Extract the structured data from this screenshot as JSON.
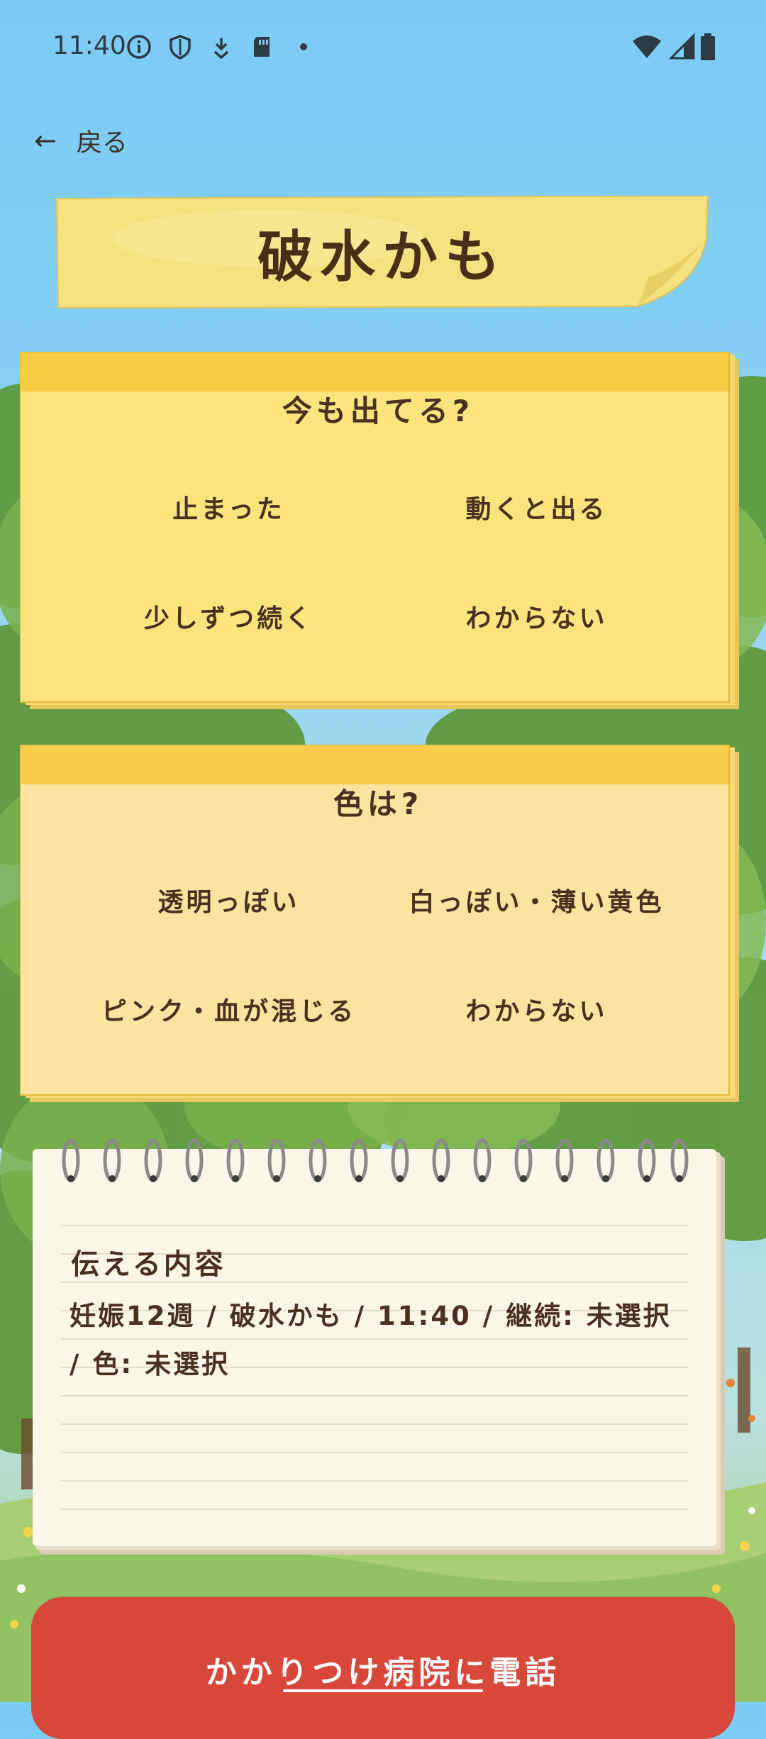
{
  "status_bar": {
    "time": "11:40",
    "left_icons": [
      "info-icon",
      "shield-icon",
      "download-icon",
      "sd-card-icon",
      "dot-icon"
    ],
    "right_icons": [
      "wifi-icon",
      "cell-signal-icon",
      "battery-icon"
    ]
  },
  "nav": {
    "back_label": "戻る",
    "back_icon": "arrow-left-icon"
  },
  "page": {
    "title": "破水かも"
  },
  "questions": [
    {
      "title": "今も出てる?",
      "options": [
        "止まった",
        "動くと出る",
        "少しずつ続く",
        "わからない"
      ]
    },
    {
      "title": "色は?",
      "options": [
        "透明っぽい",
        "白っぽい・薄い黄色",
        "ピンク・血が混じる",
        "わからない"
      ]
    }
  ],
  "summary": {
    "label": "伝える内容",
    "text": "妊娠12週 / 破水かも / 11:40 / 継続: 未選択 / 色: 未選択"
  },
  "call_button": {
    "label": "かかりつけ病院に電話"
  },
  "colors": {
    "sky": "#7ccbf4",
    "card_yellow": "#fbe27a",
    "card_orange": "#fde3a0",
    "option_green": "#dfe68e",
    "call_red": "#d7483a",
    "text_brown": "#4a3020"
  }
}
